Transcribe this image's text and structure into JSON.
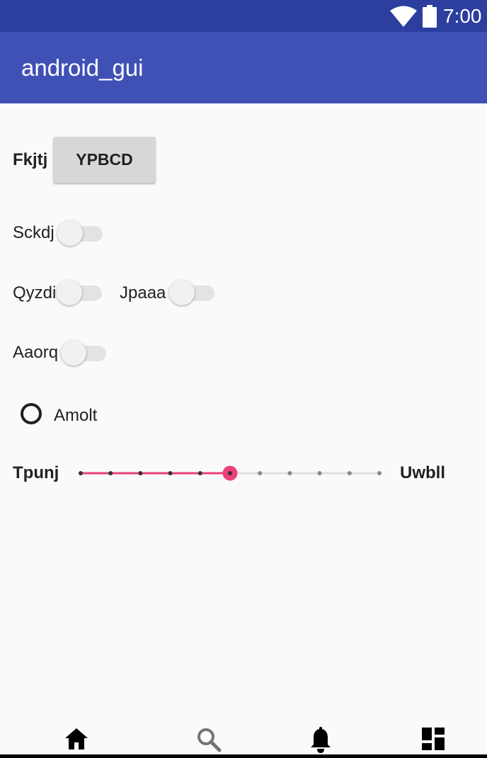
{
  "status_bar": {
    "time": "7:00",
    "icons": [
      "wifi-icon",
      "battery-icon"
    ]
  },
  "app_bar": {
    "title": "android_gui"
  },
  "form": {
    "button_row": {
      "label": "Fkjtj",
      "button_label": "YPBCD"
    },
    "switch_1": {
      "label": "Sckdj",
      "checked": false
    },
    "switch_2": {
      "label": "Qyzdi",
      "checked": false
    },
    "switch_3": {
      "label": "Jpaaa",
      "checked": false
    },
    "switch_4": {
      "label": "Aaorq",
      "checked": false
    },
    "radio": {
      "label": "Amolt",
      "checked": false
    },
    "slider": {
      "left_label": "Tpunj",
      "right_label": "Uwbll",
      "min": 0,
      "max": 10,
      "value": 5,
      "steps": 10
    }
  },
  "bottom_nav": {
    "items": [
      {
        "name": "home",
        "icon": "home-icon",
        "active": true
      },
      {
        "name": "search",
        "icon": "search-icon",
        "active": false
      },
      {
        "name": "notifications",
        "icon": "bell-icon",
        "active": false
      },
      {
        "name": "dashboard",
        "icon": "dashboard-icon",
        "active": false
      }
    ]
  },
  "colors": {
    "status_bar": "#2c3e9e",
    "app_bar": "#3f51b5",
    "accent": "#ec407a",
    "background": "#fafafa"
  }
}
